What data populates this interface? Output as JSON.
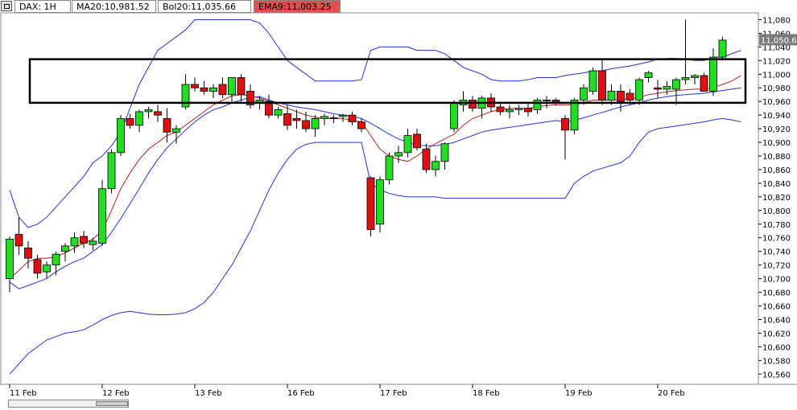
{
  "header": {
    "symbol": "DAX: 1H",
    "ma": "MA20:10,981.52",
    "bol": "Bol20:11,035.66",
    "ema": "EMA9:11,003.25"
  },
  "colors": {
    "up": "#22dd22",
    "down": "#dd1111",
    "band": "#2233cc",
    "ma": "#aa2222",
    "price_label_bg": "#7a7a7a",
    "ema_label_bg": "#e05050",
    "frame_bg": "#ffffff"
  },
  "icons": {
    "menu": "window-menu-icon"
  },
  "chart_data": {
    "type": "candlestick",
    "ylim": [
      10545,
      11090
    ],
    "y_ticks": [
      10560,
      10580,
      10600,
      10620,
      10640,
      10660,
      10680,
      10700,
      10720,
      10740,
      10760,
      10780,
      10800,
      10820,
      10840,
      10860,
      10880,
      10900,
      10920,
      10940,
      10960,
      10980,
      11000,
      11020,
      11040,
      11060,
      11080
    ],
    "y_tick_labels": [
      "10,560",
      "10,580",
      "10,600",
      "10,620",
      "10,640",
      "10,660",
      "10,680",
      "10,700",
      "10,720",
      "10,740",
      "10,760",
      "10,780",
      "10,800",
      "10,820",
      "10,840",
      "10,860",
      "10,880",
      "10,900",
      "10,920",
      "10,940",
      "10,960",
      "10,980",
      "11,000",
      "11,020",
      "11,040",
      "11,060",
      "11,080"
    ],
    "x_labels": [
      {
        "text": "11 Feb",
        "index": 0
      },
      {
        "text": "12 Feb",
        "index": 10
      },
      {
        "text": "13 Feb",
        "index": 20
      },
      {
        "text": "16 Feb",
        "index": 30
      },
      {
        "text": "17 Feb",
        "index": 40
      },
      {
        "text": "18 Feb",
        "index": 50
      },
      {
        "text": "19 Feb",
        "index": 60
      },
      {
        "text": "20 Feb",
        "index": 70
      }
    ],
    "last_price": "11,050.6",
    "last_price_value": 11050.6,
    "n_slots": 80,
    "candles": [
      {
        "o": 10700,
        "h": 10762,
        "l": 10680,
        "c": 10758
      },
      {
        "o": 10765,
        "h": 10790,
        "l": 10735,
        "c": 10748
      },
      {
        "o": 10745,
        "h": 10755,
        "l": 10715,
        "c": 10730
      },
      {
        "o": 10728,
        "h": 10735,
        "l": 10700,
        "c": 10708
      },
      {
        "o": 10710,
        "h": 10725,
        "l": 10700,
        "c": 10720
      },
      {
        "o": 10720,
        "h": 10740,
        "l": 10705,
        "c": 10736
      },
      {
        "o": 10740,
        "h": 10752,
        "l": 10725,
        "c": 10748
      },
      {
        "o": 10748,
        "h": 10768,
        "l": 10738,
        "c": 10760
      },
      {
        "o": 10762,
        "h": 10770,
        "l": 10745,
        "c": 10752
      },
      {
        "o": 10750,
        "h": 10760,
        "l": 10742,
        "c": 10755
      },
      {
        "o": 10752,
        "h": 10845,
        "l": 10748,
        "c": 10832
      },
      {
        "o": 10832,
        "h": 10890,
        "l": 10825,
        "c": 10885
      },
      {
        "o": 10885,
        "h": 10940,
        "l": 10880,
        "c": 10935
      },
      {
        "o": 10935,
        "h": 10942,
        "l": 10920,
        "c": 10925
      },
      {
        "o": 10925,
        "h": 10948,
        "l": 10915,
        "c": 10945
      },
      {
        "o": 10945,
        "h": 10952,
        "l": 10935,
        "c": 10948
      },
      {
        "o": 10945,
        "h": 10955,
        "l": 10930,
        "c": 10940
      },
      {
        "o": 10935,
        "h": 10950,
        "l": 10900,
        "c": 10915
      },
      {
        "o": 10915,
        "h": 10925,
        "l": 10898,
        "c": 10920
      },
      {
        "o": 10952,
        "h": 11000,
        "l": 10948,
        "c": 10985
      },
      {
        "o": 10985,
        "h": 10995,
        "l": 10975,
        "c": 10980
      },
      {
        "o": 10980,
        "h": 10990,
        "l": 10970,
        "c": 10975
      },
      {
        "o": 10975,
        "h": 10985,
        "l": 10965,
        "c": 10980
      },
      {
        "o": 10985,
        "h": 10995,
        "l": 10965,
        "c": 10970
      },
      {
        "o": 10970,
        "h": 10995,
        "l": 10960,
        "c": 10995
      },
      {
        "o": 10995,
        "h": 11000,
        "l": 10960,
        "c": 10970
      },
      {
        "o": 10975,
        "h": 10985,
        "l": 10950,
        "c": 10955
      },
      {
        "o": 10958,
        "h": 10968,
        "l": 10948,
        "c": 10962
      },
      {
        "o": 10960,
        "h": 10970,
        "l": 10935,
        "c": 10940
      },
      {
        "o": 10940,
        "h": 10952,
        "l": 10935,
        "c": 10948
      },
      {
        "o": 10942,
        "h": 10955,
        "l": 10918,
        "c": 10925
      },
      {
        "o": 10935,
        "h": 10948,
        "l": 10920,
        "c": 10932
      },
      {
        "o": 10932,
        "h": 10945,
        "l": 10915,
        "c": 10920
      },
      {
        "o": 10920,
        "h": 10940,
        "l": 10908,
        "c": 10935
      },
      {
        "o": 10935,
        "h": 10942,
        "l": 10925,
        "c": 10938
      },
      {
        "o": 10936,
        "h": 10940,
        "l": 10928,
        "c": 10935
      },
      {
        "o": 10938,
        "h": 10942,
        "l": 10930,
        "c": 10940
      },
      {
        "o": 10940,
        "h": 10945,
        "l": 10925,
        "c": 10930
      },
      {
        "o": 10930,
        "h": 10935,
        "l": 10915,
        "c": 10920
      },
      {
        "o": 10848,
        "h": 10850,
        "l": 10762,
        "c": 10772
      },
      {
        "o": 10780,
        "h": 10850,
        "l": 10768,
        "c": 10845
      },
      {
        "o": 10845,
        "h": 10885,
        "l": 10838,
        "c": 10880
      },
      {
        "o": 10880,
        "h": 10895,
        "l": 10870,
        "c": 10885
      },
      {
        "o": 10885,
        "h": 10920,
        "l": 10878,
        "c": 10910
      },
      {
        "o": 10912,
        "h": 10920,
        "l": 10888,
        "c": 10892
      },
      {
        "o": 10890,
        "h": 10898,
        "l": 10855,
        "c": 10860
      },
      {
        "o": 10860,
        "h": 10880,
        "l": 10850,
        "c": 10872
      },
      {
        "o": 10872,
        "h": 10900,
        "l": 10860,
        "c": 10898
      },
      {
        "o": 10920,
        "h": 10962,
        "l": 10915,
        "c": 10958
      },
      {
        "o": 10955,
        "h": 10975,
        "l": 10945,
        "c": 10962
      },
      {
        "o": 10962,
        "h": 10968,
        "l": 10945,
        "c": 10950
      },
      {
        "o": 10950,
        "h": 10968,
        "l": 10935,
        "c": 10965
      },
      {
        "o": 10965,
        "h": 10972,
        "l": 10945,
        "c": 10952
      },
      {
        "o": 10952,
        "h": 10958,
        "l": 10940,
        "c": 10945
      },
      {
        "o": 10945,
        "h": 10955,
        "l": 10935,
        "c": 10948
      },
      {
        "o": 10948,
        "h": 10955,
        "l": 10940,
        "c": 10950
      },
      {
        "o": 10950,
        "h": 10958,
        "l": 10938,
        "c": 10945
      },
      {
        "o": 10948,
        "h": 10965,
        "l": 10942,
        "c": 10962
      },
      {
        "o": 10962,
        "h": 10968,
        "l": 10950,
        "c": 10962
      },
      {
        "o": 10962,
        "h": 10965,
        "l": 10955,
        "c": 10960
      },
      {
        "o": 10935,
        "h": 10940,
        "l": 10875,
        "c": 10918
      },
      {
        "o": 10918,
        "h": 10965,
        "l": 10912,
        "c": 10962
      },
      {
        "o": 10962,
        "h": 10985,
        "l": 10955,
        "c": 10980
      },
      {
        "o": 10975,
        "h": 11010,
        "l": 10970,
        "c": 11005
      },
      {
        "o": 11005,
        "h": 11022,
        "l": 10955,
        "c": 10962
      },
      {
        "o": 10962,
        "h": 10985,
        "l": 10955,
        "c": 10975
      },
      {
        "o": 10975,
        "h": 10985,
        "l": 10945,
        "c": 10960
      },
      {
        "o": 10972,
        "h": 10978,
        "l": 10955,
        "c": 10962
      },
      {
        "o": 10962,
        "h": 10995,
        "l": 10955,
        "c": 10992
      },
      {
        "o": 10995,
        "h": 11005,
        "l": 10988,
        "c": 11002
      },
      {
        "o": 10980,
        "h": 10992,
        "l": 10965,
        "c": 10978
      },
      {
        "o": 10978,
        "h": 10990,
        "l": 10970,
        "c": 10982
      },
      {
        "o": 10978,
        "h": 10995,
        "l": 10955,
        "c": 10992
      },
      {
        "o": 10992,
        "h": 11080,
        "l": 10985,
        "c": 10995
      },
      {
        "o": 10995,
        "h": 11000,
        "l": 10985,
        "c": 10998
      },
      {
        "o": 10998,
        "h": 11002,
        "l": 10980,
        "c": 10975
      },
      {
        "o": 10975,
        "h": 11038,
        "l": 10968,
        "c": 11025
      },
      {
        "o": 11025,
        "h": 11055,
        "l": 11020,
        "c": 11050
      }
    ],
    "upper_band": [
      10830,
      10790,
      10775,
      10780,
      10790,
      10805,
      10820,
      10835,
      10850,
      10870,
      10880,
      10895,
      10915,
      10950,
      10985,
      11010,
      11035,
      11045,
      11055,
      11065,
      11080,
      11080,
      11080,
      11080,
      11080,
      11080,
      11080,
      11075,
      11060,
      11040,
      11020,
      11010,
      11000,
      10990,
      10990,
      10990,
      10990,
      10990,
      10992,
      11035,
      11040,
      11040,
      11040,
      11040,
      11035,
      11035,
      11035,
      11030,
      11020,
      11010,
      11005,
      11000,
      10992,
      10990,
      10990,
      10990,
      10992,
      10995,
      10995,
      10995,
      10998,
      11000,
      11002,
      11005,
      11005,
      11008,
      11010,
      11012,
      11015,
      11018,
      11022,
      11023,
      11023,
      11022,
      11020,
      11020,
      11025,
      11025,
      11030,
      11035
    ],
    "lower_band": [
      10560,
      10575,
      10590,
      10600,
      10610,
      10615,
      10620,
      10622,
      10625,
      10632,
      10640,
      10646,
      10650,
      10652,
      10650,
      10648,
      10647,
      10647,
      10648,
      10650,
      10656,
      10665,
      10680,
      10700,
      10720,
      10745,
      10770,
      10800,
      10830,
      10855,
      10875,
      10890,
      10897,
      10900,
      10900,
      10900,
      10900,
      10900,
      10900,
      10840,
      10830,
      10825,
      10822,
      10820,
      10820,
      10820,
      10820,
      10818,
      10818,
      10818,
      10818,
      10818,
      10818,
      10818,
      10818,
      10818,
      10818,
      10818,
      10818,
      10818,
      10818,
      10840,
      10850,
      10858,
      10862,
      10866,
      10870,
      10880,
      10900,
      10915,
      10920,
      10922,
      10924,
      10926,
      10928,
      10930,
      10933,
      10935,
      10933,
      10930
    ],
    "middle_band": [
      10695,
      10685,
      10690,
      10695,
      10700,
      10710,
      10718,
      10725,
      10730,
      10740,
      10750,
      10768,
      10788,
      10810,
      10832,
      10855,
      10875,
      10892,
      10905,
      10918,
      10930,
      10940,
      10948,
      10952,
      10958,
      10962,
      10966,
      10967,
      10962,
      10958,
      10955,
      10952,
      10950,
      10948,
      10945,
      10942,
      10940,
      10938,
      10935,
      10928,
      10920,
      10912,
      10905,
      10900,
      10896,
      10895,
      10895,
      10897,
      10900,
      10905,
      10910,
      10915,
      10918,
      10920,
      10922,
      10924,
      10926,
      10928,
      10930,
      10932,
      10930,
      10932,
      10936,
      10940,
      10944,
      10948,
      10952,
      10955,
      10958,
      10962,
      10965,
      10967,
      10969,
      10970,
      10971,
      10972,
      10974,
      10976,
      10978,
      10980
    ],
    "ma_line": [
      10700,
      10712,
      10725,
      10730,
      10730,
      10732,
      10738,
      10745,
      10752,
      10758,
      10770,
      10800,
      10832,
      10855,
      10875,
      10890,
      10900,
      10910,
      10915,
      10925,
      10935,
      10945,
      10955,
      10962,
      10968,
      10970,
      10968,
      10965,
      10960,
      10955,
      10950,
      10945,
      10940,
      10937,
      10935,
      10935,
      10935,
      10932,
      10930,
      10910,
      10890,
      10880,
      10875,
      10872,
      10880,
      10890,
      10898,
      10905,
      10912,
      10925,
      10935,
      10940,
      10945,
      10948,
      10950,
      10950,
      10950,
      10952,
      10954,
      10955,
      10955,
      10955,
      10958,
      10962,
      10962,
      10962,
      10963,
      10964,
      10966,
      10970,
      10972,
      10974,
      10976,
      10977,
      10978,
      10978,
      10980,
      10985,
      10990,
      10998
    ]
  }
}
